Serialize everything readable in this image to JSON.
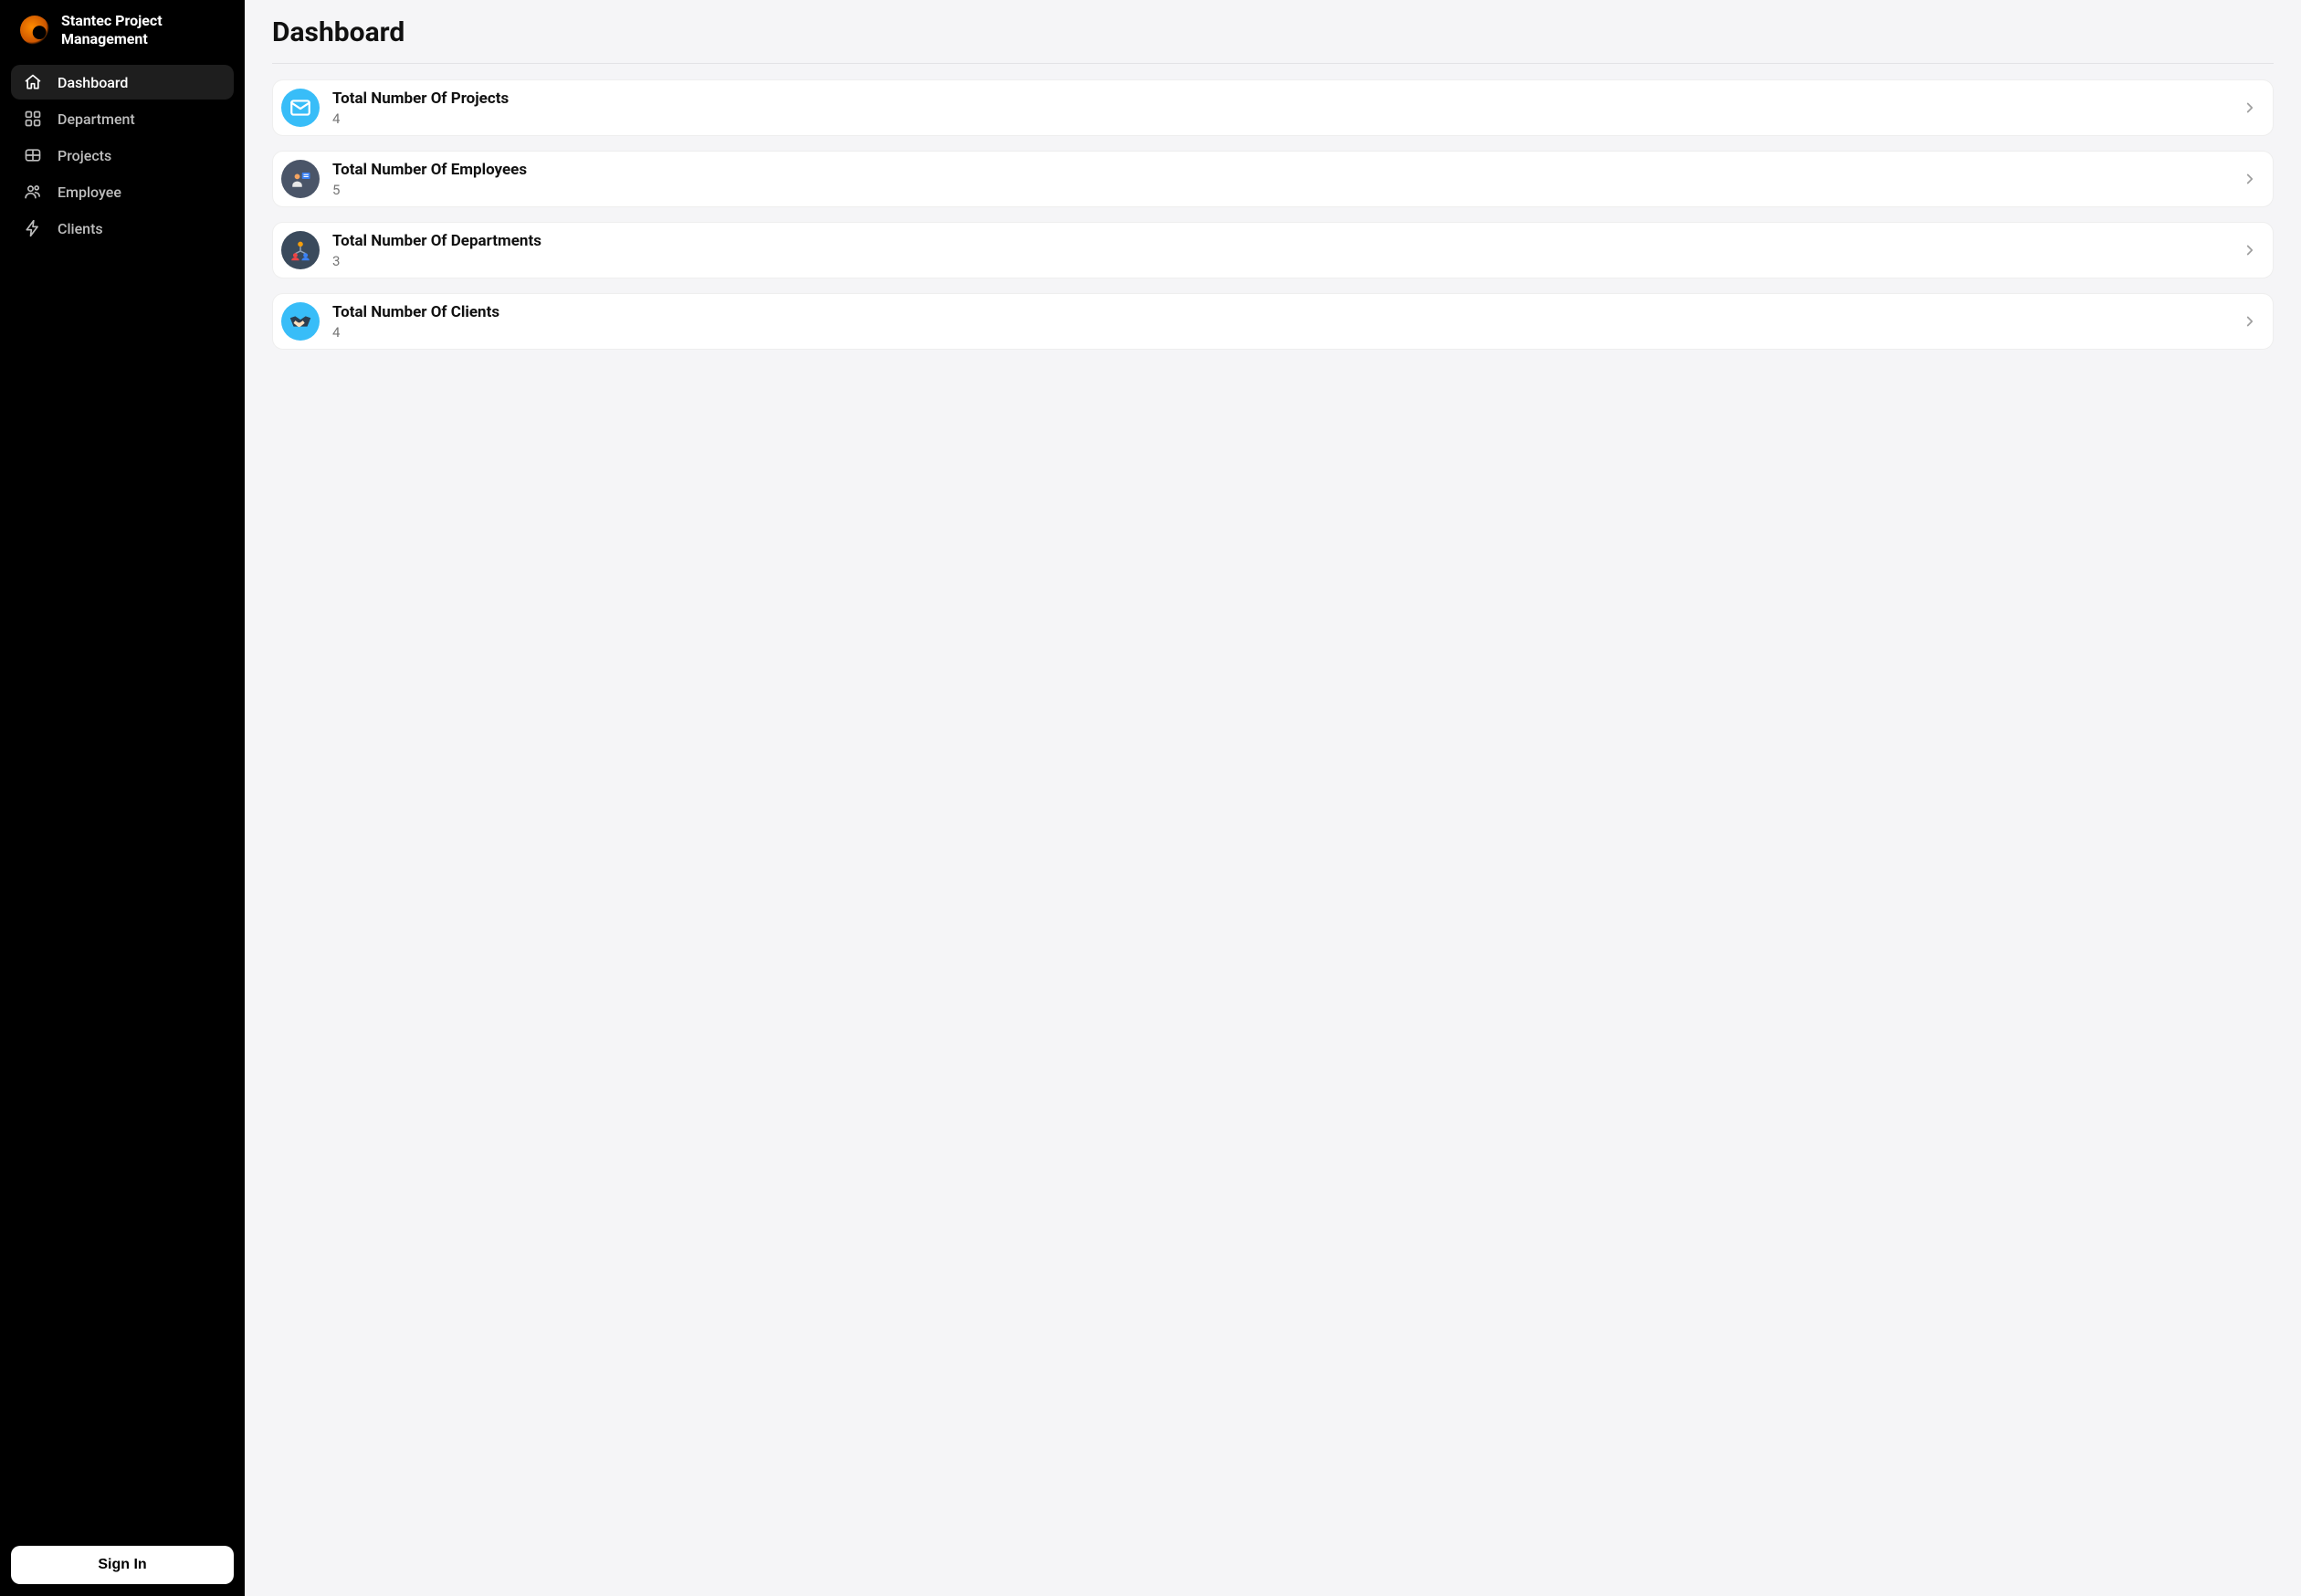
{
  "brand": {
    "title": "Stantec Project Management"
  },
  "sidebar": {
    "items": [
      {
        "label": "Dashboard",
        "icon": "home-icon",
        "active": true
      },
      {
        "label": "Department",
        "icon": "grid-icon",
        "active": false
      },
      {
        "label": "Projects",
        "icon": "layers-icon",
        "active": false
      },
      {
        "label": "Employee",
        "icon": "users-icon",
        "active": false
      },
      {
        "label": "Clients",
        "icon": "bolt-icon",
        "active": false
      }
    ],
    "signin_label": "Sign In"
  },
  "page": {
    "title": "Dashboard"
  },
  "cards": [
    {
      "title": "Total Number Of Projects",
      "value": "4",
      "icon_class": "ic-projects",
      "icon": "mail-icon"
    },
    {
      "title": "Total Number Of Employees",
      "value": "5",
      "icon_class": "ic-employees",
      "icon": "person-card-icon"
    },
    {
      "title": "Total Number Of Departments",
      "value": "3",
      "icon_class": "ic-departments",
      "icon": "org-icon"
    },
    {
      "title": "Total Number Of Clients",
      "value": "4",
      "icon_class": "ic-clients",
      "icon": "handshake-icon"
    }
  ]
}
